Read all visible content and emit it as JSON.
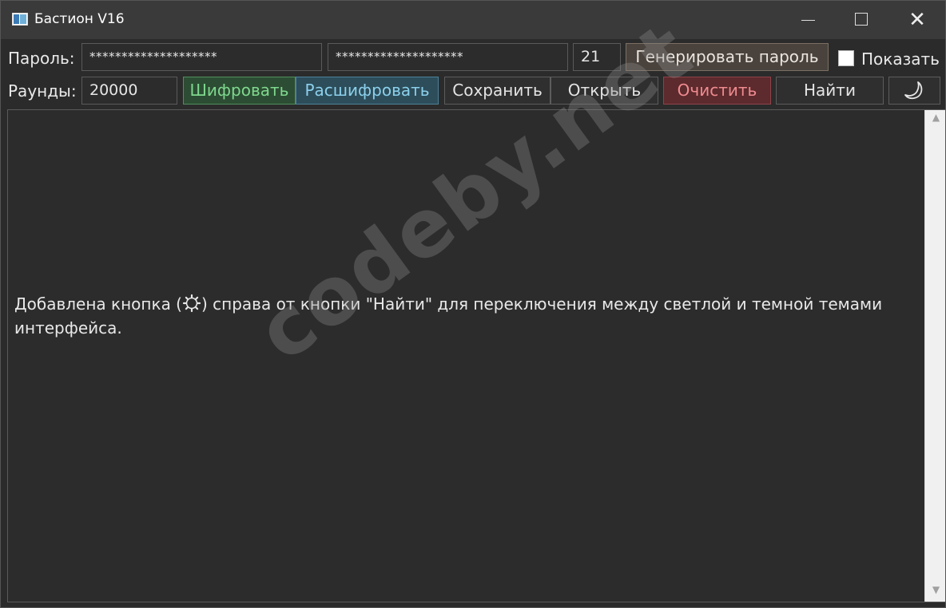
{
  "window": {
    "title": "Бастион V16",
    "controls": {
      "minimize": "minimize-icon",
      "maximize": "maximize-icon",
      "close": "close-icon"
    }
  },
  "row1": {
    "password_label": "Пароль:",
    "password_value": "********************",
    "password_confirm_value": "********************",
    "length_value": "21",
    "generate_label": "Генерировать пароль",
    "show_label": "Показать",
    "show_checked": false
  },
  "row2": {
    "rounds_label": "Раунды:",
    "rounds_value": "20000",
    "encrypt_label": "Шифровать",
    "decrypt_label": "Расшифровать",
    "save_label": "Сохранить",
    "open_label": "Открыть",
    "clear_label": "Очистить",
    "find_label": "Найти",
    "theme_icon": "moon-icon"
  },
  "editor": {
    "text_before_icon": "Добавлена кнопка (",
    "text_after_icon": ") справа от кнопки \"Найти\" для переключения между светлой и темной темами интерфейса.",
    "inline_icon": "gear-icon"
  },
  "watermark": "codeby.net",
  "colors": {
    "background": "#2b2b2b",
    "encrypt": "#7fd88e",
    "decrypt": "#8bd0ec",
    "clear": "#ef8b8f"
  }
}
